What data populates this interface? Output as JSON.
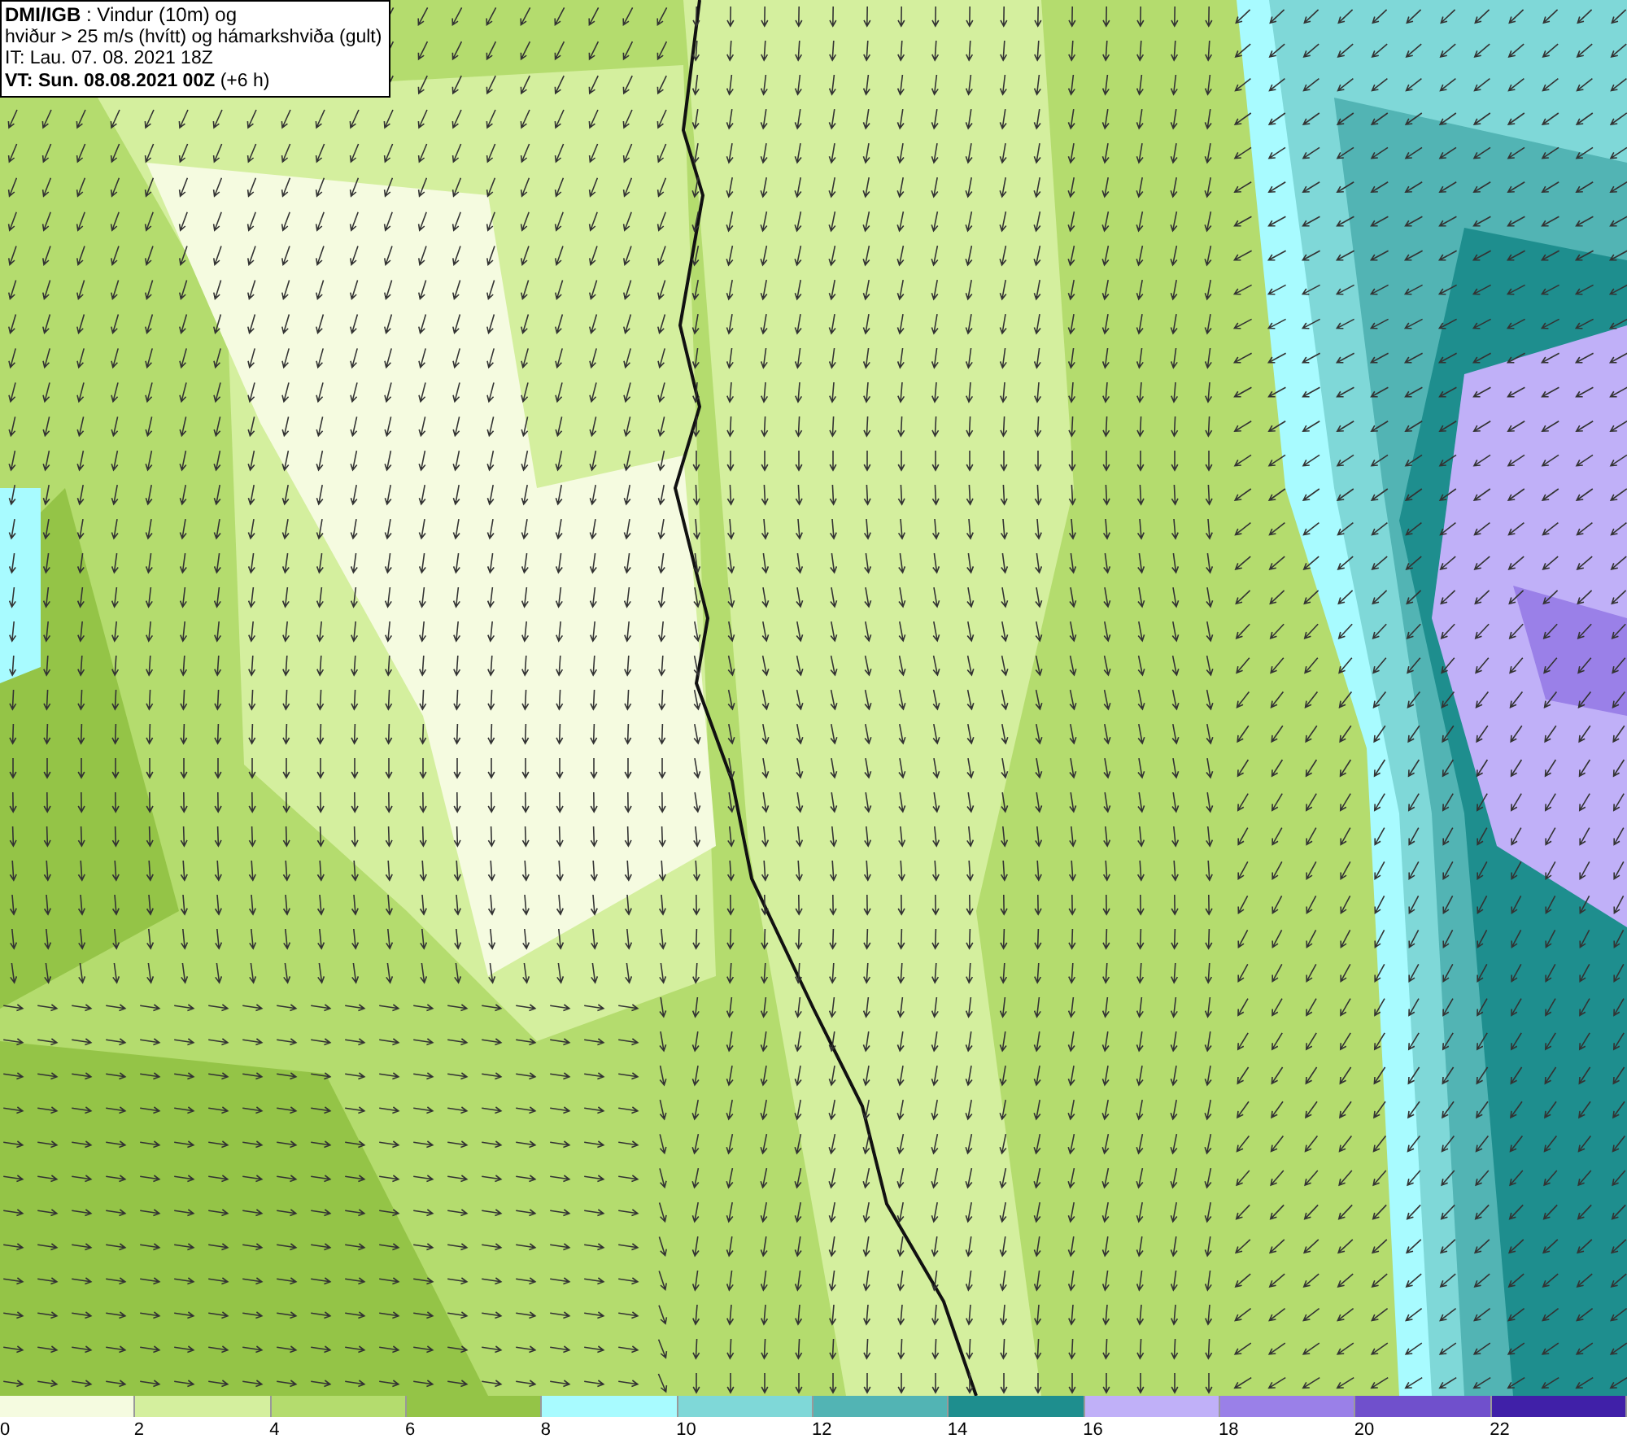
{
  "info_box": {
    "lines": [
      "**DMI/IGB** : Vindur (10m) og",
      "hviður > 25 m/s (hvítt) og hámarkshviða (gult)",
      "IT: Lau. 07. 08. 2021 18Z",
      "**VT: Sun. 08.08.2021 00Z** (+6 h)"
    ]
  },
  "legend": [
    {
      "label": "0",
      "color": "#f5fbe0"
    },
    {
      "label": "2",
      "color": "#d4ef9e"
    },
    {
      "label": "4",
      "color": "#b4dc6e"
    },
    {
      "label": "6",
      "color": "#94c447"
    },
    {
      "label": "8",
      "color": "#a8fbff"
    },
    {
      "label": "10",
      "color": "#7fd8d8"
    },
    {
      "label": "12",
      "color": "#52b4b4"
    },
    {
      "label": "14",
      "color": "#1e8e8e"
    },
    {
      "label": "16",
      "color": "#c0b0f8"
    },
    {
      "label": "18",
      "color": "#9a80e8"
    },
    {
      "label": "20",
      "color": "#7050cc"
    },
    {
      "label": "22",
      "color": "#4020a8"
    }
  ]
}
